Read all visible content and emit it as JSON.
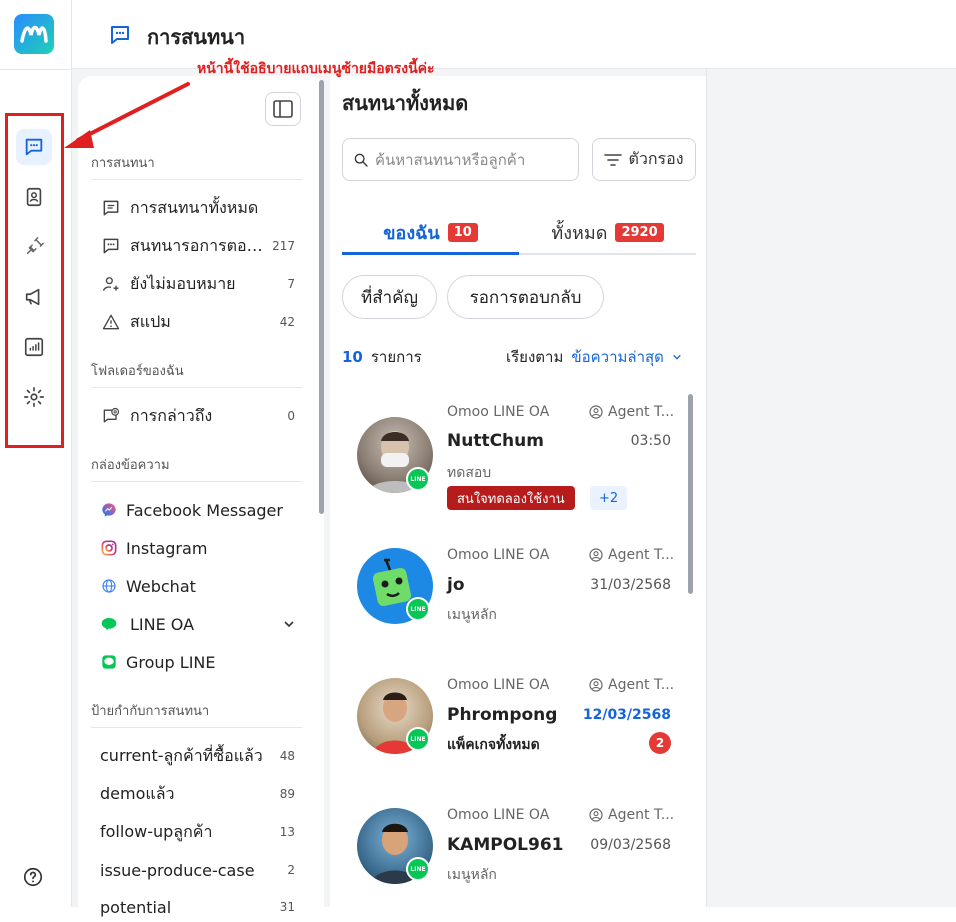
{
  "header": {
    "title": "การสนทนา"
  },
  "annotation": {
    "text": "หน้านี้ใช้อธิบายแถบเมนูซ้ายมือตรงนี้ค่ะ"
  },
  "rail": {
    "items": [
      {
        "icon": "chat-icon",
        "active": true
      },
      {
        "icon": "contacts-icon"
      },
      {
        "icon": "plug-icon"
      },
      {
        "icon": "megaphone-icon"
      },
      {
        "icon": "report-icon"
      },
      {
        "icon": "gear-icon"
      }
    ]
  },
  "sidebar": {
    "sections": {
      "conversations": "การสนทนา",
      "myfolders": "โฟลเดอร์ของฉัน",
      "inbox": "กล่องข้อความ",
      "labels": "ป้ายกำกับการสนทนา"
    },
    "conversations": [
      {
        "label": "การสนทนาทั้งหมด",
        "count": ""
      },
      {
        "label": "สนทนารอการตอบกลับ",
        "count": "217"
      },
      {
        "label": "ยังไม่มอบหมาย",
        "count": "7"
      },
      {
        "label": "สแปม",
        "count": "42"
      }
    ],
    "folders": [
      {
        "label": "การกล่าวถึง",
        "count": "0"
      }
    ],
    "inboxes": [
      {
        "label": "Facebook Messager"
      },
      {
        "label": "Instagram"
      },
      {
        "label": "Webchat"
      },
      {
        "label": "LINE OA"
      },
      {
        "label": "Group LINE"
      }
    ],
    "labels": [
      {
        "label": "current-ลูกค้าที่ซื้อแล้ว",
        "count": "48"
      },
      {
        "label": "demoแล้ว",
        "count": "89"
      },
      {
        "label": "follow-upลูกค้า",
        "count": "13"
      },
      {
        "label": "issue-produce-case",
        "count": "2"
      },
      {
        "label": "potential",
        "count": "31"
      }
    ]
  },
  "list": {
    "title": "สนทนาทั้งหมด",
    "search_placeholder": "ค้นหาสนทนาหรือลูกค้า",
    "filter_label": "ตัวกรอง",
    "tabs": [
      {
        "label": "ของฉัน",
        "badge": "10"
      },
      {
        "label": "ทั้งหมด",
        "badge": "2920"
      }
    ],
    "chips": [
      "ที่สำคัญ",
      "รอการตอบกลับ"
    ],
    "count": "10",
    "count_label": "รายการ",
    "sort_label": "เรียงตาม",
    "sort_value": "ข้อความล่าสุด",
    "items": [
      {
        "source": "Omoo LINE OA",
        "agent": "Agent T...",
        "name": "NuttChum",
        "time": "03:50",
        "message": "ทดสอบ",
        "tag": "สนใจทดลองใช้งาน",
        "more": "+2"
      },
      {
        "source": "Omoo LINE OA",
        "agent": "Agent T...",
        "name": "jo",
        "time": "31/03/2568",
        "message": "เมนูหลัก"
      },
      {
        "source": "Omoo LINE OA",
        "agent": "Agent T...",
        "name": "Phrompong",
        "time": "12/03/2568",
        "message": "แพ็คเกจทั้งหมด",
        "unread": "2"
      },
      {
        "source": "Omoo LINE OA",
        "agent": "Agent T...",
        "name": "KAMPOL961",
        "time": "09/03/2568",
        "message": "เมนูหลัก"
      }
    ],
    "line_badge": "LINE"
  },
  "colors": {
    "accent": "#1565d8",
    "danger": "#e53935",
    "line": "#06c755"
  }
}
